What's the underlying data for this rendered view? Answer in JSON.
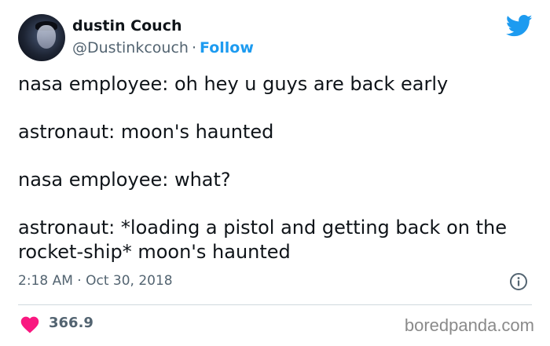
{
  "author": {
    "display_name": "dustin Couch",
    "handle": "@Dustinkcouch",
    "separator": "·",
    "follow_label": "Follow"
  },
  "tweet": {
    "lines": [
      "nasa employee: oh hey u guys are back early",
      "astronaut: moon's haunted",
      "nasa employee: what?",
      "astronaut: *loading a pistol and getting back on the rocket-ship* moon's haunted"
    ],
    "timestamp": "2:18 AM · Oct 30, 2018"
  },
  "engagement": {
    "likes": "366.9"
  },
  "watermark": "boredpanda.com",
  "icons": {
    "brand": "twitter-bird-icon",
    "info": "info-icon",
    "like": "heart-icon"
  },
  "colors": {
    "text": "#0f1419",
    "secondary": "#536471",
    "accent": "#1d9bf0",
    "heart": "#f91880",
    "divider": "#cfd9de",
    "watermark": "#8a8a8a"
  }
}
